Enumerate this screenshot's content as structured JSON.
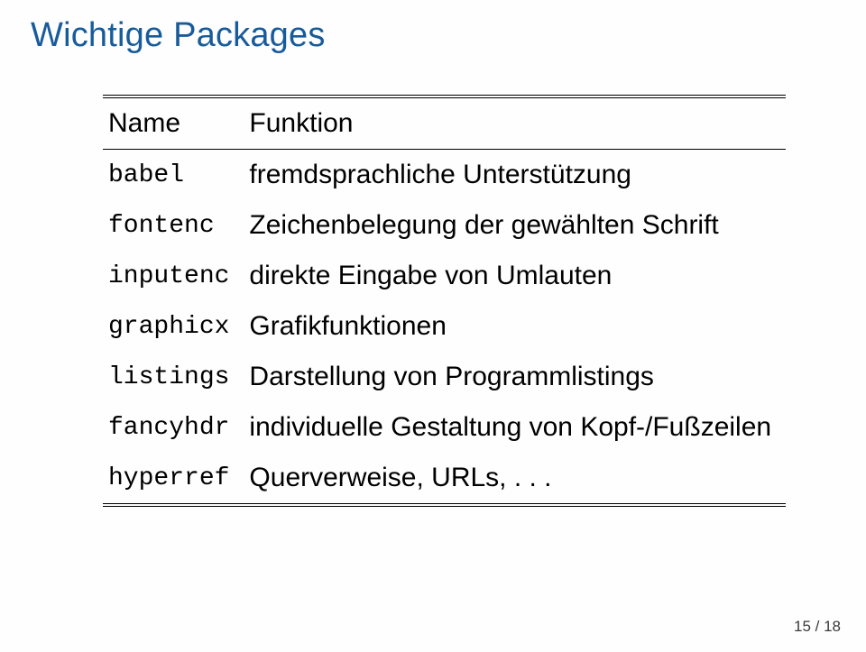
{
  "title": "Wichtige Packages",
  "header": {
    "name": "Name",
    "function": "Funktion"
  },
  "rows": [
    {
      "name": "babel",
      "func": "fremdsprachliche Unterstützung"
    },
    {
      "name": "fontenc",
      "func": "Zeichenbelegung der gewählten Schrift"
    },
    {
      "name": "inputenc",
      "func": "direkte Eingabe von Umlauten"
    },
    {
      "name": "graphicx",
      "func": "Grafikfunktionen"
    },
    {
      "name": "listings",
      "func": "Darstellung von Programmlistings"
    },
    {
      "name": "fancyhdr",
      "func": "individuelle Gestaltung von Kopf-/Fußzeilen"
    },
    {
      "name": "hyperref",
      "func": "Querverweise, URLs, . . ."
    }
  ],
  "page_number": "15 / 18"
}
